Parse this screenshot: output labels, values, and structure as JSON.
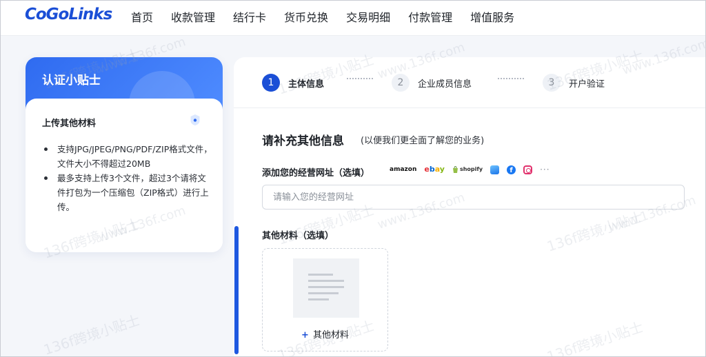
{
  "brand": {
    "logo_text": "CoGoLinks"
  },
  "nav": {
    "items": [
      {
        "label": "首页"
      },
      {
        "label": "收款管理"
      },
      {
        "label": "结行卡"
      },
      {
        "label": "货币兑换"
      },
      {
        "label": "交易明细"
      },
      {
        "label": "付款管理"
      },
      {
        "label": "增值服务"
      }
    ]
  },
  "tips": {
    "title": "认证小贴士",
    "subtitle": "上传其他材料",
    "icon": "shield-icon",
    "items": [
      {
        "text": "支持JPG/JPEG/PNG/PDF/ZIP格式文件， 文件大小不得超过20MB"
      },
      {
        "text": "最多支持上传3个文件，超过3个请将文件打包为一个压缩包（ZIP格式）进行上传。"
      }
    ]
  },
  "steps": [
    {
      "number": "1",
      "label": "主体信息",
      "active": true
    },
    {
      "number": "2",
      "label": "企业成员信息",
      "active": false
    },
    {
      "number": "3",
      "label": "开户验证",
      "active": false
    }
  ],
  "form": {
    "title": "请补充其他信息",
    "note": "(以便我们更全面了解您的业务)",
    "website": {
      "label": "添加您的经营网址（选填）",
      "placeholder": "请输入您的经营网址",
      "value": "",
      "platforms": {
        "amazon": "amazon",
        "ebay_e": "e",
        "ebay_b": "b",
        "ebay_a": "a",
        "ebay_y": "y",
        "shopify": "shopify",
        "facebook": "f",
        "more": "···"
      }
    },
    "materials": {
      "label": "其他材料（选填）",
      "upload_plus": "+",
      "upload_label": "其他材料"
    }
  },
  "watermark": {
    "text_a": "136f跨境小贴士",
    "text_b": "www.136f.com"
  },
  "colors": {
    "primary": "#1b4fd6",
    "header_gradient_start": "#2f6bf0",
    "header_gradient_end": "#4f8cff",
    "ebay_red": "#e53238",
    "ebay_blue": "#0064d2",
    "ebay_yellow": "#f5af02",
    "ebay_green": "#86b817",
    "facebook": "#1877f2",
    "instagram": "#e1306c"
  }
}
